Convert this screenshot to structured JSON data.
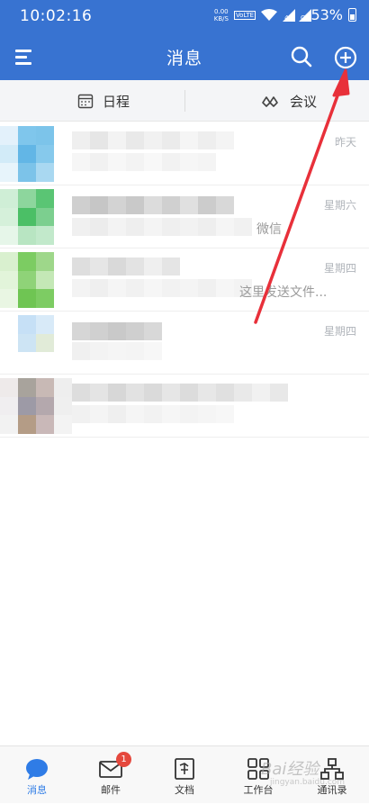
{
  "status_bar": {
    "time": "10:02:16",
    "net_speed": "0.00",
    "net_unit": "KB/S",
    "volte": "VoLTE",
    "signal_1": "4G",
    "signal_2": "G",
    "battery": "53%"
  },
  "header": {
    "title": "消息",
    "icons": [
      "menu-icon",
      "search-icon",
      "add-circle-icon"
    ]
  },
  "subnav": {
    "schedule_label": "日程",
    "meeting_label": "会议"
  },
  "conversations": [
    {
      "time": "昨天",
      "preview": ""
    },
    {
      "time": "星期六",
      "preview": "微信"
    },
    {
      "time": "星期四",
      "preview": "这里发送文件..."
    },
    {
      "time": "星期四",
      "preview": ""
    },
    {
      "time": "",
      "preview": ""
    }
  ],
  "tabbar": {
    "tabs": [
      {
        "label": "消息",
        "active": true
      },
      {
        "label": "邮件",
        "badge": "1"
      },
      {
        "label": "文档"
      },
      {
        "label": "工作台"
      },
      {
        "label": "通讯录"
      }
    ]
  },
  "watermark": {
    "text": "Bai经验",
    "sub": "jingyan.baidu.com"
  },
  "colors": {
    "brand": "#3873d1",
    "active_tab": "#2f7ce6",
    "badge": "#e5483d",
    "arrow": "#e8303a"
  }
}
